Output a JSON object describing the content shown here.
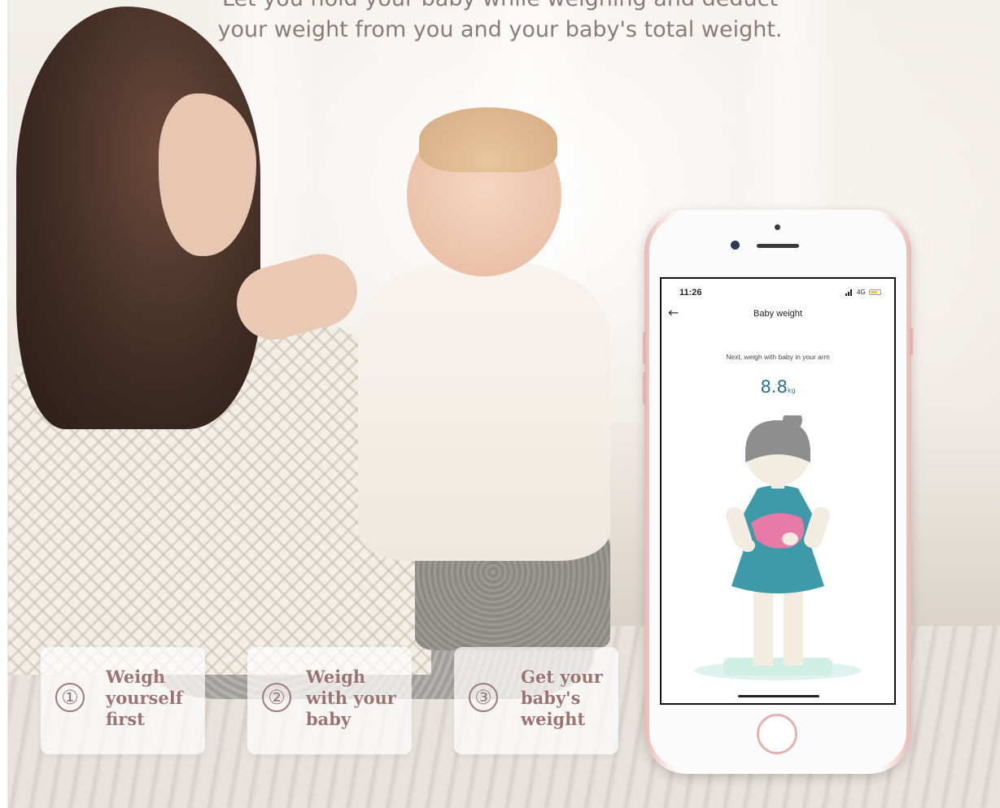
{
  "heading": {
    "line1": "Let you hold your baby while weighing and deduct",
    "line2": "your weight from you and your baby's total weight."
  },
  "steps": [
    {
      "number": "①",
      "label": "Weigh yourself first"
    },
    {
      "number": "②",
      "label": "Weigh with your baby"
    },
    {
      "number": "③",
      "label": "Get your baby's weight"
    }
  ],
  "phone": {
    "status": {
      "time": "11:26",
      "network": "4G"
    },
    "nav": {
      "back_icon": "arrow-left-icon",
      "title": "Baby weight"
    },
    "instruction": "Next, weigh with baby in your arm",
    "weight": {
      "value": "8.8",
      "unit": "kg"
    }
  },
  "colors": {
    "heading_text": "#8b7b78",
    "step_text": "#9b7370",
    "weight_text": "#2f6f88",
    "phone_frame": "#e7b9b4",
    "dress": "#3e9aa8",
    "baby_blanket": "#e77aa6"
  }
}
